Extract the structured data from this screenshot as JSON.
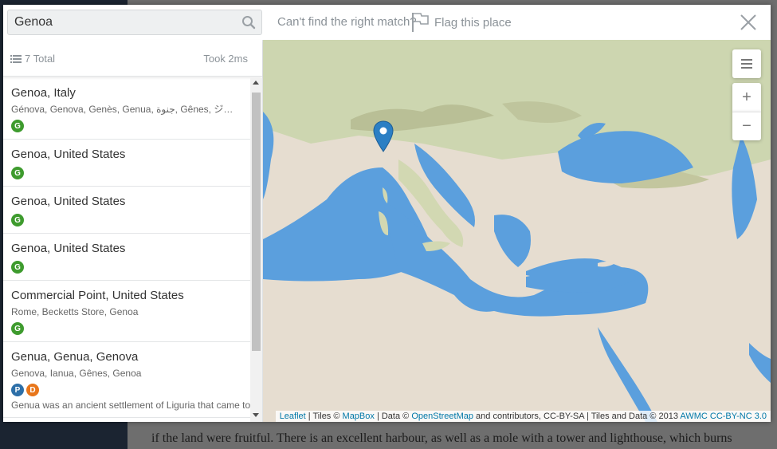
{
  "background": {
    "text": "if the land were fruitful. There is an excellent harbour, as well as a mole with a tower and lighthouse, which burns"
  },
  "search": {
    "value": "Genoa",
    "icon": "search-icon"
  },
  "topbar": {
    "cant_find": "Can't find the right match?",
    "flag_label": "Flag this place",
    "flag_icon": "flag-icon",
    "close_icon": "close-icon"
  },
  "results": {
    "total_label": "7 Total",
    "took_label": "Took 2ms",
    "items": [
      {
        "title": "Genoa, Italy",
        "names": "Génova, Genova, Genès, Genua, جنوة, Gênes, ジェノヴ...",
        "badges": [
          {
            "letter": "G",
            "color": "#3e9b2e"
          }
        ]
      },
      {
        "title": "Genoa, United States",
        "names": "",
        "badges": [
          {
            "letter": "G",
            "color": "#3e9b2e"
          }
        ]
      },
      {
        "title": "Genoa, United States",
        "names": "",
        "badges": [
          {
            "letter": "G",
            "color": "#3e9b2e"
          }
        ]
      },
      {
        "title": "Genoa, United States",
        "names": "",
        "badges": [
          {
            "letter": "G",
            "color": "#3e9b2e"
          }
        ]
      },
      {
        "title": "Commercial Point, United States",
        "names": "Rome, Becketts Store, Genoa",
        "badges": [
          {
            "letter": "G",
            "color": "#3e9b2e"
          }
        ]
      },
      {
        "title": "Genua, Genua, Genova",
        "names": "Genova, Ianua, Gênes, Genoa",
        "badges": [
          {
            "letter": "P",
            "color": "#2d6fa8"
          },
          {
            "letter": "D",
            "color": "#e8761b"
          }
        ],
        "description": "Genua was an ancient settlement of Liguria that came to"
      }
    ]
  },
  "map": {
    "controls": {
      "layers_icon": "layers-icon",
      "zoom_in": "+",
      "zoom_out": "−"
    },
    "marker_icon": "map-marker-icon",
    "attribution": {
      "leaflet": "Leaflet",
      "tiles_prefix": " | Tiles © ",
      "mapbox": "MapBox",
      "data_prefix": " | Data © ",
      "osm": "OpenStreetMap",
      "data_suffix": " and contributors, CC-BY-SA | Tiles and Data © 2013 ",
      "awmc": "AWMC CC-BY-NC 3.0"
    },
    "colors": {
      "sea": "#5b9fdd",
      "land": "#e6ddd0",
      "vegetation": "#cdd6b0",
      "mountain": "#b9bf96"
    }
  }
}
